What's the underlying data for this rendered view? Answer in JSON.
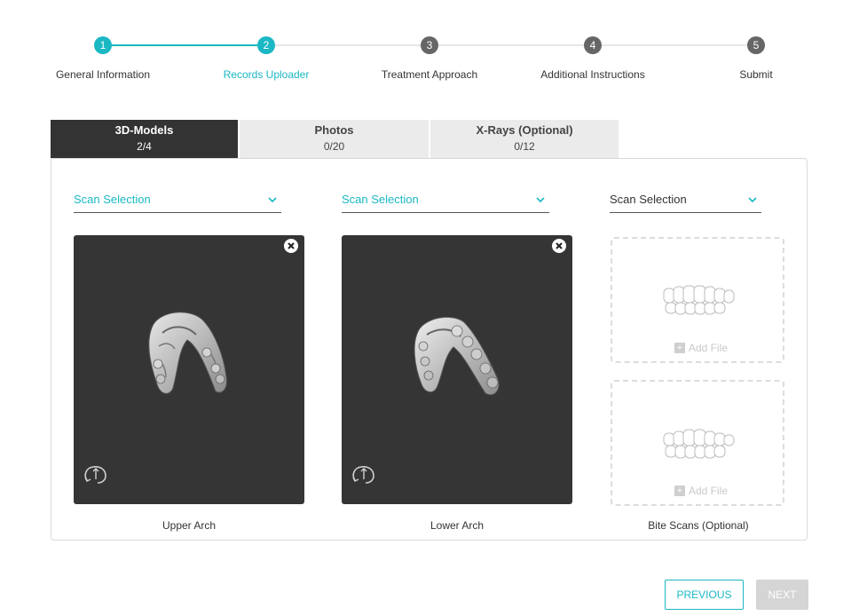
{
  "stepper": {
    "steps": [
      {
        "number": "1",
        "label": "General Information",
        "state": "complete"
      },
      {
        "number": "2",
        "label": "Records Uploader",
        "state": "current"
      },
      {
        "number": "3",
        "label": "Treatment Approach",
        "state": "pending"
      },
      {
        "number": "4",
        "label": "Additional Instructions",
        "state": "pending"
      },
      {
        "number": "5",
        "label": "Submit",
        "state": "pending"
      }
    ]
  },
  "tabs": [
    {
      "name": "3D-Models",
      "count": "2/4",
      "active": true
    },
    {
      "name": "Photos",
      "count": "0/20",
      "active": false
    },
    {
      "name": "X-Rays (Optional)",
      "count": "0/12",
      "active": false
    }
  ],
  "columns": [
    {
      "select": "Scan Selection",
      "label": "Upper Arch",
      "state": "uploaded"
    },
    {
      "select": "Scan Selection",
      "label": "Lower Arch",
      "state": "uploaded"
    },
    {
      "select": "Scan Selection",
      "label": "Bite Scans (Optional)",
      "state": "empty"
    }
  ],
  "bite_slots": [
    {
      "add_label": "Add File"
    },
    {
      "add_label": "Add File"
    }
  ],
  "icons": {
    "close": "close-icon",
    "rotate": "rotate-view-icon",
    "chevron": "chevron-down-icon",
    "plus": "plus-icon"
  },
  "buttons": {
    "previous": "PREVIOUS",
    "next": "NEXT"
  },
  "colors": {
    "accent": "#1bb8c4",
    "dark": "#333333",
    "step_pending": "#666666",
    "disabled": "#d5d5d5"
  }
}
